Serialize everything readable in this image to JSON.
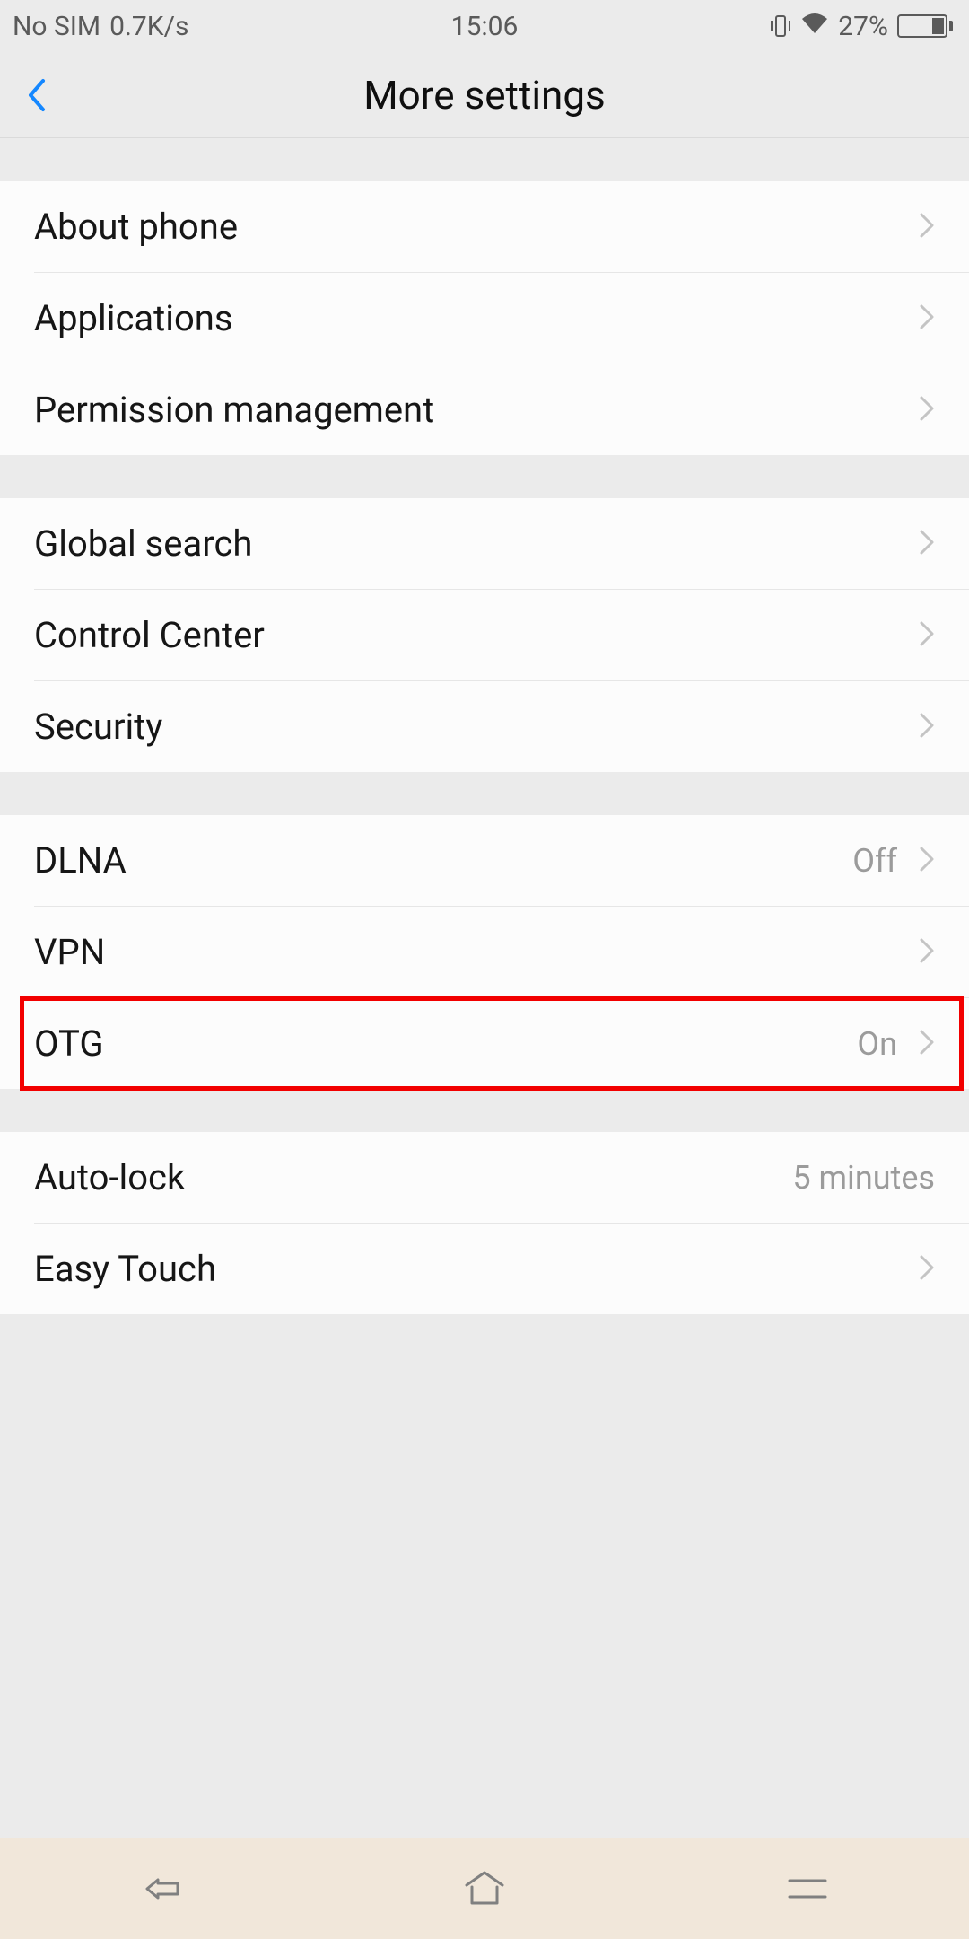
{
  "status": {
    "sim": "No SIM",
    "speed": "0.7K/s",
    "time": "15:06",
    "battery_pct": "27%"
  },
  "header": {
    "title": "More settings"
  },
  "groups": [
    {
      "rows": [
        {
          "label": "About phone",
          "value": ""
        },
        {
          "label": "Applications",
          "value": ""
        },
        {
          "label": "Permission management",
          "value": ""
        }
      ]
    },
    {
      "rows": [
        {
          "label": "Global search",
          "value": ""
        },
        {
          "label": "Control Center",
          "value": ""
        },
        {
          "label": "Security",
          "value": ""
        }
      ]
    },
    {
      "rows": [
        {
          "label": "DLNA",
          "value": "Off"
        },
        {
          "label": "VPN",
          "value": ""
        },
        {
          "label": "OTG",
          "value": "On"
        }
      ]
    },
    {
      "rows": [
        {
          "label": "Auto-lock",
          "value": "5 minutes"
        },
        {
          "label": "Easy Touch",
          "value": ""
        }
      ]
    }
  ]
}
